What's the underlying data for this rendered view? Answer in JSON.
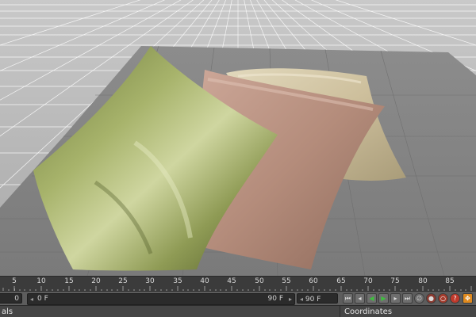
{
  "timeline": {
    "ruler_numbers": [
      "5",
      "10",
      "15",
      "20",
      "25",
      "30",
      "35",
      "40",
      "45",
      "50",
      "55",
      "60",
      "65",
      "70",
      "75",
      "80",
      "85"
    ],
    "start_frame": "0 F",
    "end_frame": "90 F",
    "current_frame": "90 F"
  },
  "panels": {
    "left_title": "als",
    "right_title": "Coordinates"
  },
  "transport_icons": [
    "go-to-start-icon",
    "step-back-icon",
    "play-backward-icon",
    "play-forward-icon",
    "step-forward-icon",
    "go-to-end-icon"
  ],
  "record_icons": [
    "keyframe-selection-icon",
    "record-icon",
    "autokey-icon",
    "help-icon"
  ],
  "tool_icons": [
    "move-icon",
    "scale-icon",
    "grid-icon"
  ],
  "colors": {
    "pillow_green": "#8a9a55",
    "pillow_pink": "#b89484",
    "pillow_cream": "#cbbf9f",
    "play_green": "#3fbf3f",
    "record_red": "#d43a2a",
    "orange_tool": "#e08a1e"
  }
}
